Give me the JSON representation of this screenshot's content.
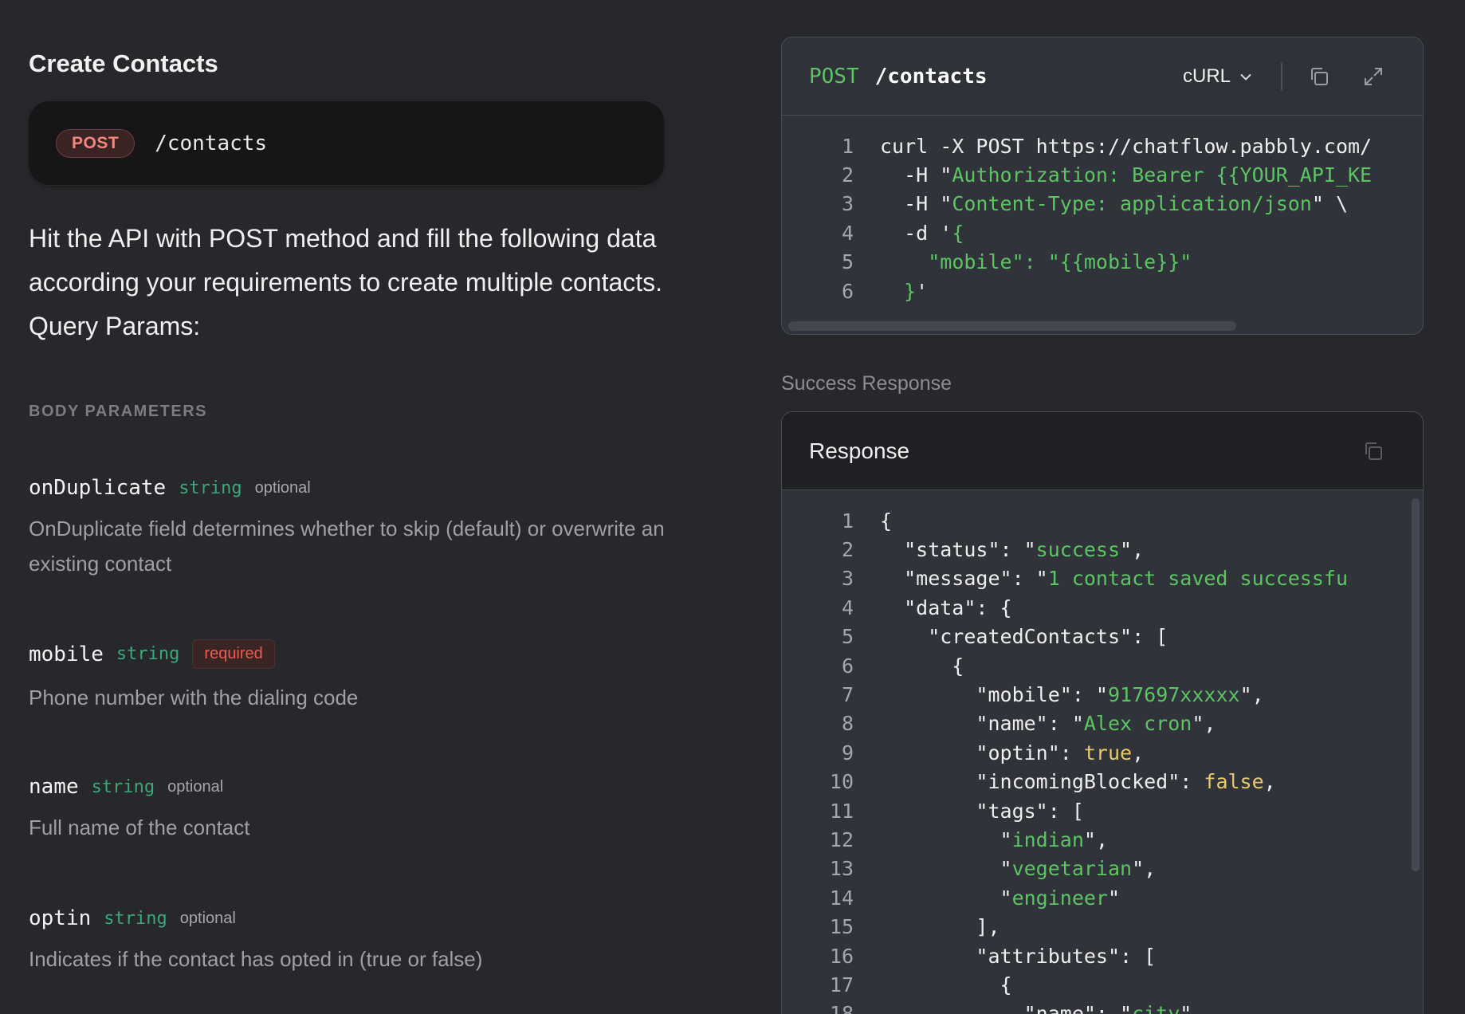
{
  "page": {
    "title": "Create Contacts",
    "endpoint": {
      "method": "POST",
      "path": "/contacts"
    },
    "description": "Hit the API with POST method and fill the following data according your requirements to create multiple contacts. Query Params:",
    "section_label": "BODY PARAMETERS"
  },
  "params": [
    {
      "name": "onDuplicate",
      "type": "string",
      "flag": "optional",
      "desc": "OnDuplicate field determines whether to skip (default) or overwrite an existing contact"
    },
    {
      "name": "mobile",
      "type": "string",
      "flag": "required",
      "desc": "Phone number with the dialing code"
    },
    {
      "name": "name",
      "type": "string",
      "flag": "optional",
      "desc": "Full name of the contact"
    },
    {
      "name": "optin",
      "type": "string",
      "flag": "optional",
      "desc": "Indicates if the contact has opted in (true or false)"
    }
  ],
  "request": {
    "method": "POST",
    "path": "/contacts",
    "language": "cURL",
    "lines": [
      "curl -X POST https://chatflow.pabbly.com/",
      "  -H \"Authorization: Bearer {{YOUR_API_KE",
      "  -H \"Content-Type: application/json\" \\",
      "  -d '{",
      "    \"mobile\": \"{{mobile}}\"",
      "  }'"
    ]
  },
  "response": {
    "section_label": "Success Response",
    "title": "Response",
    "lines": [
      "{",
      "  \"status\": \"success\",",
      "  \"message\": \"1 contact saved successfu",
      "  \"data\": {",
      "    \"createdContacts\": [",
      "      {",
      "        \"mobile\": \"917697xxxxx\",",
      "        \"name\": \"Alex cron\",",
      "        \"optin\": true,",
      "        \"incomingBlocked\": false,",
      "        \"tags\": [",
      "          \"indian\",",
      "          \"vegetarian\",",
      "          \"engineer\"",
      "        ],",
      "        \"attributes\": [",
      "          {",
      "            \"name\": \"city\","
    ]
  },
  "colors": {
    "accent_green": "#5cc463",
    "method_red": "#f1867f",
    "type_green": "#3aa879",
    "bool_yellow": "#e8c96b"
  },
  "icons": {
    "copy": "copy-icon",
    "expand": "expand-icon",
    "chevron": "chevron-down-icon"
  }
}
